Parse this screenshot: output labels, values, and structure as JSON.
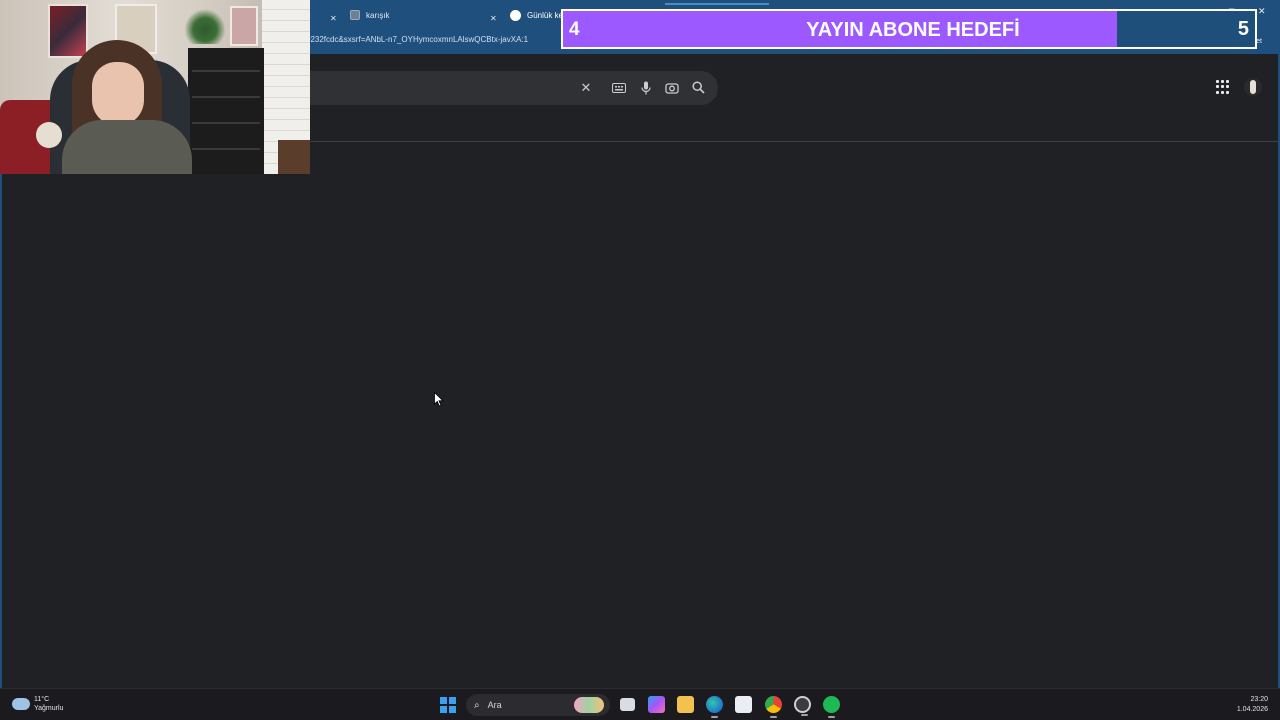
{
  "browser": {
    "tabs": [
      {
        "label": ""
      },
      {
        "label": "karışık"
      },
      {
        "label": "Günlük ke"
      }
    ],
    "url": "0232fcdc&sxsrf=ANbL-n7_OYHymcoxmnLAlswQCBtx-javXA:1",
    "chat_label": "Sohbet et",
    "window_controls": {
      "minimize": "—",
      "maximize": "□",
      "close": "✕"
    }
  },
  "page": {
    "search_value": ""
  },
  "overlay": {
    "current": "4",
    "title": "YAYIN ABONE HEDEFİ",
    "target": "5",
    "progress_fraction": 0.8,
    "fill_color": "#9b59ff"
  },
  "taskbar": {
    "weather_temp": "11°C",
    "weather_desc": "Yağmurlu",
    "search_label": "Ara",
    "time": "23:20",
    "date": "1.04.2026"
  },
  "icons": [
    "close-icon",
    "keyboard-icon",
    "microphone-icon",
    "camera-search-icon",
    "search-icon",
    "apps-grid-icon",
    "history-icon",
    "share-icon",
    "more-icon",
    "copilot-icon",
    "windows-start-icon",
    "file-explorer-icon",
    "edge-icon",
    "store-icon",
    "chrome-icon",
    "spotify-icon"
  ]
}
